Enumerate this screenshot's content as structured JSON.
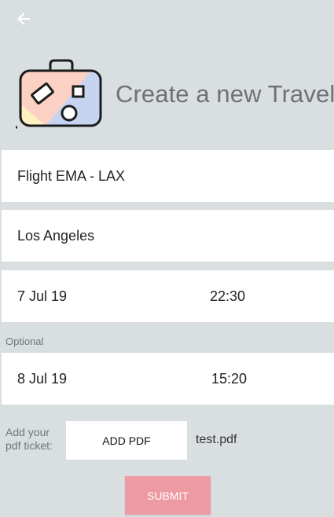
{
  "header": {
    "back_icon": "arrow-left-icon",
    "logo_icon": "suitcase-icon",
    "title": "Create a new Travel"
  },
  "form": {
    "flight_name": "Flight EMA - LAX",
    "destination": "Los Angeles",
    "departure": {
      "date": "7 Jul 19",
      "time": "22:30"
    },
    "optional_label": "Optional",
    "return": {
      "date": "8 Jul 19",
      "time": "15:20"
    },
    "pdf": {
      "label": "Add your pdf ticket:",
      "button_label": "ADD PDF",
      "file_name": "test.pdf"
    },
    "submit_label": "SUBMIT"
  },
  "colors": {
    "background": "#d9dee1",
    "field_background": "#ffffff",
    "submit_background": "#ee9aa2",
    "title_text": "#6f7173"
  }
}
